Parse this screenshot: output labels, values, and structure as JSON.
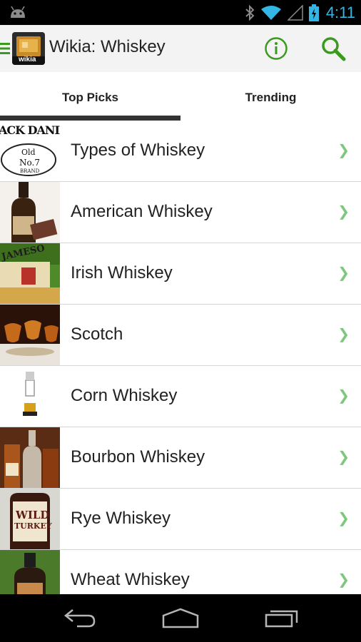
{
  "status_bar": {
    "time": "4:11",
    "icons": [
      "android-icon",
      "bluetooth-icon",
      "wifi-icon",
      "signal-icon",
      "battery-charging-icon"
    ]
  },
  "action_bar": {
    "title": "Wikia: Whiskey",
    "logo_text": "wikia",
    "info_icon": "info-icon",
    "search_icon": "search-icon",
    "accent": "#3a9a1f"
  },
  "tabs": [
    {
      "label": "Top Picks",
      "selected": true
    },
    {
      "label": "Trending",
      "selected": false
    }
  ],
  "list": {
    "items": [
      {
        "label": "Types of Whiskey",
        "thumb_text_1": "ACK DANIEL",
        "thumb_text_2": "Old",
        "thumb_text_3": "No.7",
        "thumb_text_4": "BRAND"
      },
      {
        "label": "American Whiskey"
      },
      {
        "label": "Irish Whiskey",
        "thumb_text_1": "JAMESO"
      },
      {
        "label": "Scotch"
      },
      {
        "label": "Corn Whiskey"
      },
      {
        "label": "Bourbon Whiskey"
      },
      {
        "label": "Rye Whiskey",
        "thumb_text_1": "WILD",
        "thumb_text_2": "TURKEY"
      },
      {
        "label": "Wheat Whiskey"
      }
    ],
    "chevron": "❯"
  },
  "nav_bar": {
    "buttons": [
      "back-icon",
      "home-icon",
      "recent-apps-icon"
    ]
  }
}
